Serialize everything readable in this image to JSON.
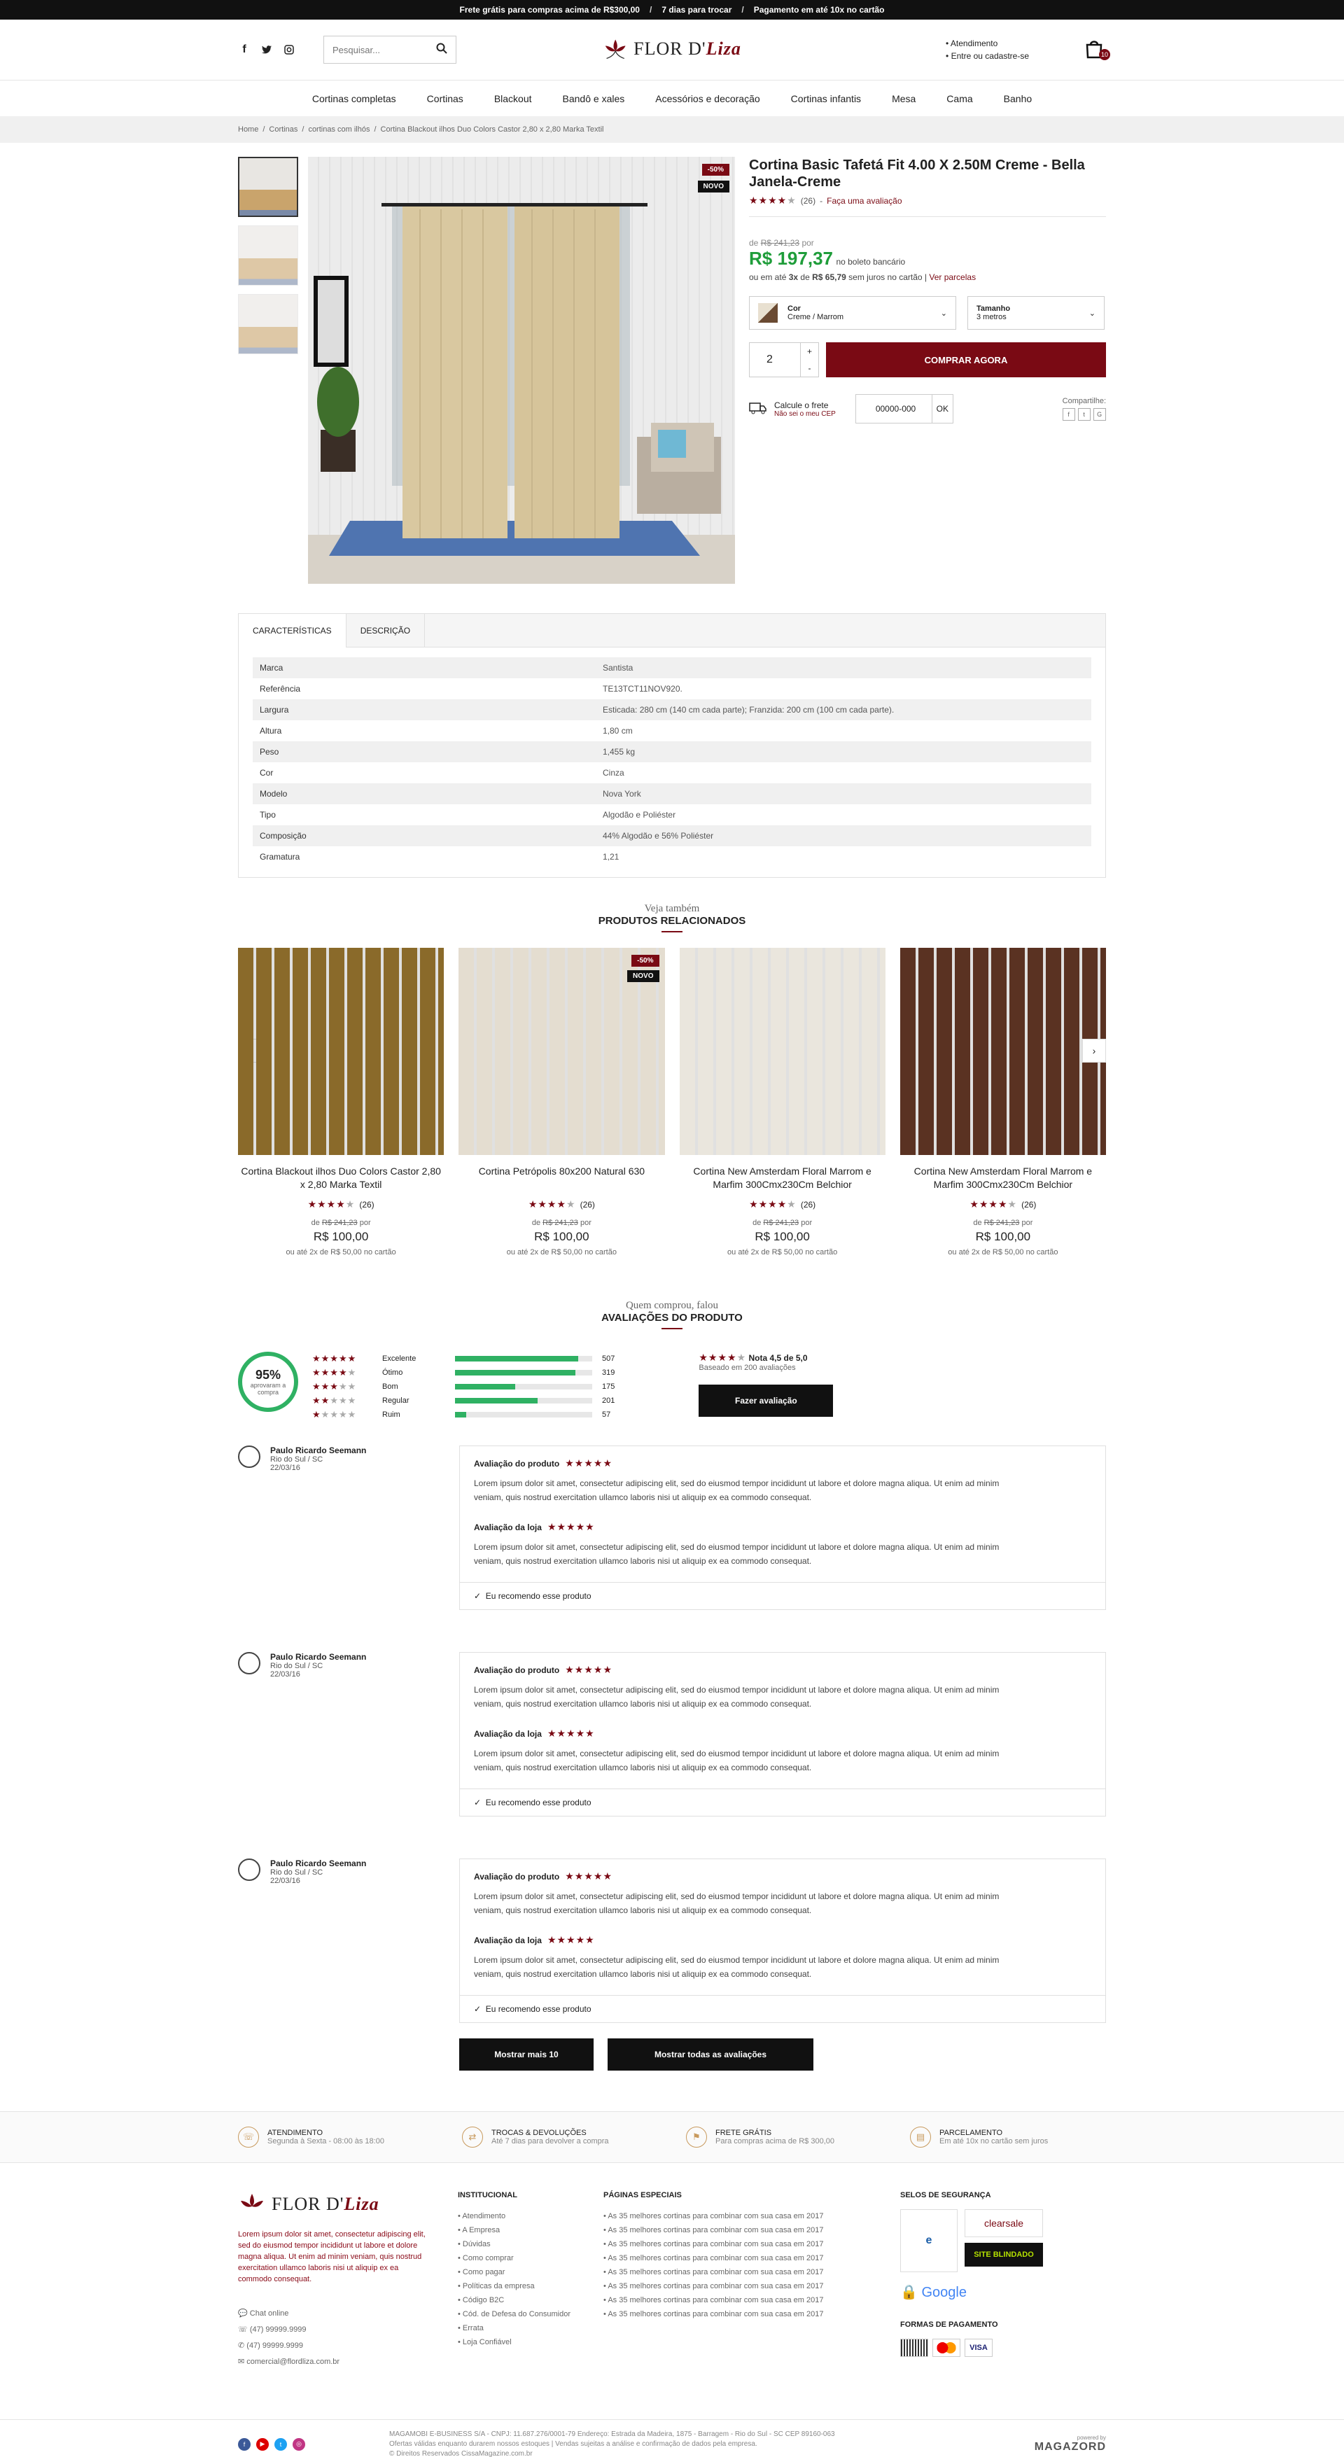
{
  "topbar": {
    "items": [
      "Frete grátis para compras acima de R$300,00",
      "7 dias para trocar",
      "Pagamento em até 10x no cartão"
    ]
  },
  "header": {
    "search_placeholder": "Pesquisar...",
    "brand_first": "FLOR D'",
    "brand_second": "Liza",
    "account": [
      "Atendimento",
      "Entre ou cadastre-se"
    ],
    "cart_count": "10"
  },
  "nav": [
    "Cortinas completas",
    "Cortinas",
    "Blackout",
    "Bandô e xales",
    "Acessórios e decoração",
    "Cortinas infantis",
    "Mesa",
    "Cama",
    "Banho"
  ],
  "breadcrumb": [
    "Home",
    "Cortinas",
    "cortinas com ilhós",
    "Cortina Blackout ilhos Duo Colors Castor 2,80 x 2,80 Marka Textil"
  ],
  "product": {
    "badges": [
      "-50%",
      "NOVO"
    ],
    "title": "Cortina Basic Tafetá Fit 4.00 X 2.50M Creme - Bella Janela-Creme",
    "rating_stars": 4,
    "review_count": "(26)",
    "review_link": "Faça uma avaliação",
    "old_price_prefix": "de",
    "old_price": "R$ 241,23",
    "old_price_suffix": "por",
    "price": "R$ 197,37",
    "price_note": "no boleto bancário",
    "installments_pre": "ou em até",
    "installments_n": "3x",
    "installments_de": "de",
    "installments_value": "R$ 65,79",
    "installments_post": "sem juros no cartão",
    "parcelas_link": "Ver parcelas",
    "color_label": "Cor",
    "color_value": "Creme / Marrom",
    "color_swatch": "#8a6a4a",
    "size_label": "Tamanho",
    "size_value": "3 metros",
    "quantity": "2",
    "buy_label": "COMPRAR AGORA",
    "shipping_label": "Calcule o frete",
    "shipping_link": "Não sei o meu CEP",
    "cep_value": "00000-000",
    "cep_ok": "OK",
    "share_label": "Compartilhe:"
  },
  "tabs": [
    "CARACTERÍSTICAS",
    "DESCRIÇÃO"
  ],
  "specs": [
    {
      "k": "Marca",
      "v": "Santista"
    },
    {
      "k": "Referência",
      "v": "TE13TCT11NOV920."
    },
    {
      "k": "Largura",
      "v": "Esticada: 280 cm (140 cm cada parte); Franzida: 200 cm (100 cm cada parte)."
    },
    {
      "k": "Altura",
      "v": "1,80 cm"
    },
    {
      "k": "Peso",
      "v": "1,455 kg"
    },
    {
      "k": "Cor",
      "v": "Cinza"
    },
    {
      "k": "Modelo",
      "v": "Nova York"
    },
    {
      "k": "Tipo",
      "v": "Algodão e Poliéster"
    },
    {
      "k": "Composição",
      "v": "44% Algodão e 56% Poliéster"
    },
    {
      "k": "Gramatura",
      "v": "1,21"
    }
  ],
  "related": {
    "kicker": "Veja também",
    "title": "PRODUTOS RELACIONADOS",
    "items": [
      {
        "name": "Cortina Blackout ilhos Duo Colors Castor 2,80 x 2,80 Marka Textil",
        "count": "(26)",
        "old_pre": "de",
        "old": "R$ 241,23",
        "old_post": "por",
        "price": "R$ 100,00",
        "inst": "ou até 2x de R$ 50,00 no cartão",
        "bg": "#8a6a2a"
      },
      {
        "name": "Cortina Petrópolis 80x200 Natural 630",
        "count": "(26)",
        "old_pre": "de",
        "old": "R$ 241,23",
        "old_post": "por",
        "price": "R$ 100,00",
        "inst": "ou até 2x de R$ 50,00 no cartão",
        "bg": "#e4ddd0",
        "badges": [
          "-50%",
          "NOVO"
        ]
      },
      {
        "name": "Cortina New Amsterdam Floral Marrom e Marfim 300Cmx230Cm Belchior",
        "count": "(26)",
        "old_pre": "de",
        "old": "R$ 241,23",
        "old_post": "por",
        "price": "R$ 100,00",
        "inst": "ou até 2x de R$ 50,00 no cartão",
        "bg": "#eae6dd"
      },
      {
        "name": "Cortina New Amsterdam Floral Marrom e Marfim 300Cmx230Cm Belchior",
        "count": "(26)",
        "old_pre": "de",
        "old": "R$ 241,23",
        "old_post": "por",
        "price": "R$ 100,00",
        "inst": "ou até 2x de R$ 50,00 no cartão",
        "bg": "#5a3222"
      }
    ]
  },
  "reviews_section": {
    "kicker": "Quem comprou, falou",
    "title": "AVALIAÇÕES DO PRODUTO"
  },
  "summary": {
    "percent": "95%",
    "percent_label": "aprovaram a compra",
    "bars": [
      {
        "label": "Excelente",
        "stars": 5,
        "count": "507",
        "fill": 0.9
      },
      {
        "label": "Ótimo",
        "stars": 4,
        "count": "319",
        "fill": 0.88
      },
      {
        "label": "Bom",
        "stars": 3,
        "count": "175",
        "fill": 0.44
      },
      {
        "label": "Regular",
        "stars": 2,
        "count": "201",
        "fill": 0.6
      },
      {
        "label": "Ruim",
        "stars": 1,
        "count": "57",
        "fill": 0.08
      }
    ],
    "note_label": "Nota 4,5 de 5,0",
    "based": "Baseado em 200 avaliações",
    "button": "Fazer avaliação"
  },
  "reviews": [
    {
      "name": "Paulo Ricardo Seemann",
      "place": "Rio do Sul / SC",
      "date": "22/03/16",
      "p_title": "Avaliação do produto",
      "p_text": "Lorem ipsum dolor sit amet, consectetur adipiscing elit, sed do eiusmod tempor incididunt ut labore et dolore magna aliqua. Ut enim ad minim veniam, quis nostrud exercitation ullamco laboris nisi ut aliquip ex ea commodo consequat.",
      "s_title": "Avaliação da loja",
      "s_text": "Lorem ipsum dolor sit amet, consectetur adipiscing elit, sed do eiusmod tempor incididunt ut labore et dolore magna aliqua. Ut enim ad minim veniam, quis nostrud exercitation ullamco laboris nisi ut aliquip ex ea commodo consequat.",
      "rec": "Eu recomendo esse produto"
    },
    {
      "name": "Paulo Ricardo Seemann",
      "place": "Rio do Sul / SC",
      "date": "22/03/16",
      "p_title": "Avaliação do produto",
      "p_text": "Lorem ipsum dolor sit amet, consectetur adipiscing elit, sed do eiusmod tempor incididunt ut labore et dolore magna aliqua. Ut enim ad minim veniam, quis nostrud exercitation ullamco laboris nisi ut aliquip ex ea commodo consequat.",
      "s_title": "Avaliação da loja",
      "s_text": "Lorem ipsum dolor sit amet, consectetur adipiscing elit, sed do eiusmod tempor incididunt ut labore et dolore magna aliqua. Ut enim ad minim veniam, quis nostrud exercitation ullamco laboris nisi ut aliquip ex ea commodo consequat.",
      "rec": "Eu recomendo esse produto"
    },
    {
      "name": "Paulo Ricardo Seemann",
      "place": "Rio do Sul / SC",
      "date": "22/03/16",
      "p_title": "Avaliação do produto",
      "p_text": "Lorem ipsum dolor sit amet, consectetur adipiscing elit, sed do eiusmod tempor incididunt ut labore et dolore magna aliqua. Ut enim ad minim veniam, quis nostrud exercitation ullamco laboris nisi ut aliquip ex ea commodo consequat.",
      "s_title": "Avaliação da loja",
      "s_text": "Lorem ipsum dolor sit amet, consectetur adipiscing elit, sed do eiusmod tempor incididunt ut labore et dolore magna aliqua. Ut enim ad minim veniam, quis nostrud exercitation ullamco laboris nisi ut aliquip ex ea commodo consequat.",
      "rec": "Eu recomendo esse produto"
    }
  ],
  "review_buttons": [
    "Mostrar mais 10",
    "Mostrar todas as avaliações"
  ],
  "benefits": [
    {
      "t": "ATENDIMENTO",
      "s": "Segunda à Sexta - 08:00 às 18:00"
    },
    {
      "t": "TROCAS & DEVOLUÇÕES",
      "s": "Até 7 dias para devolver a compra"
    },
    {
      "t": "FRETE GRÁTIS",
      "s": "Para compras acima de R$ 300,00"
    },
    {
      "t": "PARCELAMENTO",
      "s": "Em até 10x no cartão sem juros"
    }
  ],
  "footer": {
    "about": "Lorem ipsum dolor sit amet, consectetur adipiscing elit, sed do eiusmod tempor incididunt ut labore et dolore magna aliqua. Ut enim ad minim veniam, quis nostrud exercitation ullamco laboris nisi ut aliquip ex ea commodo consequat.",
    "contacts": [
      "Chat online",
      "(47) 99999.9999",
      "(47) 99999.9999",
      "comercial@flordliza.com.br"
    ],
    "inst_title": "INSTITUCIONAL",
    "inst": [
      "Atendimento",
      "A Empresa",
      "Dúvidas",
      "Como comprar",
      "Como pagar",
      "Políticas da empresa",
      "Código B2C",
      "Cód. de Defesa do Consumidor",
      "Errata",
      "Loja Confiável"
    ],
    "pages_title": "PÁGINAS ESPECIAIS",
    "pages": [
      "As 35 melhores cortinas para combinar com sua casa em 2017",
      "As 35 melhores cortinas para combinar com sua casa em 2017",
      "As 35 melhores cortinas para combinar com sua casa em 2017",
      "As 35 melhores cortinas para combinar com sua casa em 2017",
      "As 35 melhores cortinas para combinar com sua casa em 2017",
      "As 35 melhores cortinas para combinar com sua casa em 2017",
      "As 35 melhores cortinas para combinar com sua casa em 2017",
      "As 35 melhores cortinas para combinar com sua casa em 2017"
    ],
    "seals_title": "SELOS DE SEGURANÇA",
    "pay_title": "FORMAS DE PAGAMENTO",
    "legal": [
      "MAGAMOBI E-BUSINESS S/A - CNPJ: 11.687.276/0001-79 Endereço: Estrada da Madeira, 1875 - Barragem - Rio do Sul - SC CEP 89160-063",
      "Ofertas válidas enquanto durarem nossos estoques | Vendas sujeitas a análise e confirmação de dados pela empresa.",
      "© Direitos Reservados CissaMagazine.com.br"
    ],
    "powered": "powered by",
    "magazord": "MAGAZORD"
  },
  "colors": {
    "brand": "#7a0a14",
    "price": "#1f9d3a",
    "bar": "#2fb163"
  }
}
